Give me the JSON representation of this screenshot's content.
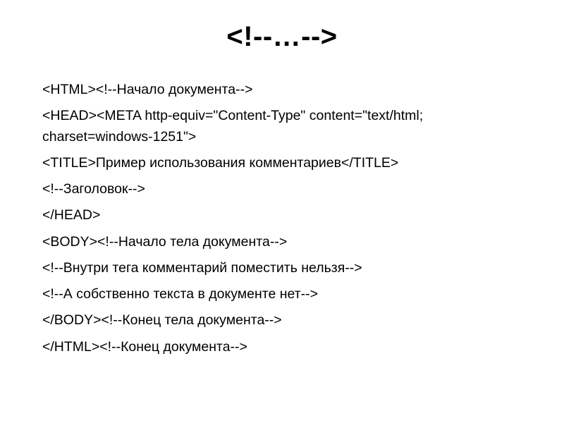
{
  "title": "<!--…-->",
  "lines": {
    "l1": "<HTML><!--Начало документа-->",
    "l2": "<HEAD><META http-equiv=\"Content-Type\" content=\"text/html; charset=windows-1251\">",
    "l3": "<TITLE>Пример использования комментариев</TITLE>",
    "l4": "<!--Заголовок-->",
    "l5": "</HEAD>",
    "l6": "<BODY><!--Начало тела документа-->",
    "l7": "<!--Внутри тега комментарий поместить нельзя-->",
    "l8": "<!--А собственно текста в документе нет-->",
    "l9": "</BODY><!--Конец тела документа-->",
    "l10": "</HTML><!--Конец документа-->"
  }
}
